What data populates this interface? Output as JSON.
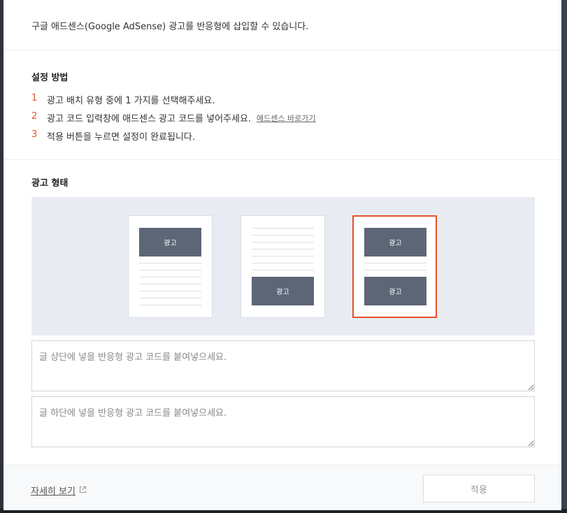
{
  "intro": {
    "text": "구글 애드센스(Google AdSense) 광고를 반응형에 삽입할 수 있습니다."
  },
  "howto": {
    "title": "설정 방법",
    "steps": [
      {
        "num": "1",
        "text": "광고 배치 유형 중에 1 가지를 선택해주세요."
      },
      {
        "num": "2",
        "text": "광고 코드 입력창에 애드센스 광고 코드를 넣어주세요.",
        "link": "애드센스 바로가기"
      },
      {
        "num": "3",
        "text": "적용 버튼을 누르면 설정이 완료됩니다."
      }
    ]
  },
  "ad_type": {
    "title": "광고 형태",
    "ad_label": "광고",
    "options": [
      {
        "id": "top",
        "selected": false
      },
      {
        "id": "bottom",
        "selected": false
      },
      {
        "id": "top-bottom",
        "selected": true
      }
    ]
  },
  "inputs": {
    "top_placeholder": "글 상단에 넣을 반응형 광고 코드를 붙여넣으세요.",
    "top_value": "",
    "bottom_placeholder": "글 하단에 넣을 반응형 광고 코드를 붙여넣으세요.",
    "bottom_value": ""
  },
  "footer": {
    "more_link": "자세히 보기",
    "more_icon": "external-link-icon",
    "apply_label": "적용"
  },
  "colors": {
    "accent": "#e5522c",
    "ad_block": "#5d6677",
    "panel_bg": "#e8ecf2"
  }
}
